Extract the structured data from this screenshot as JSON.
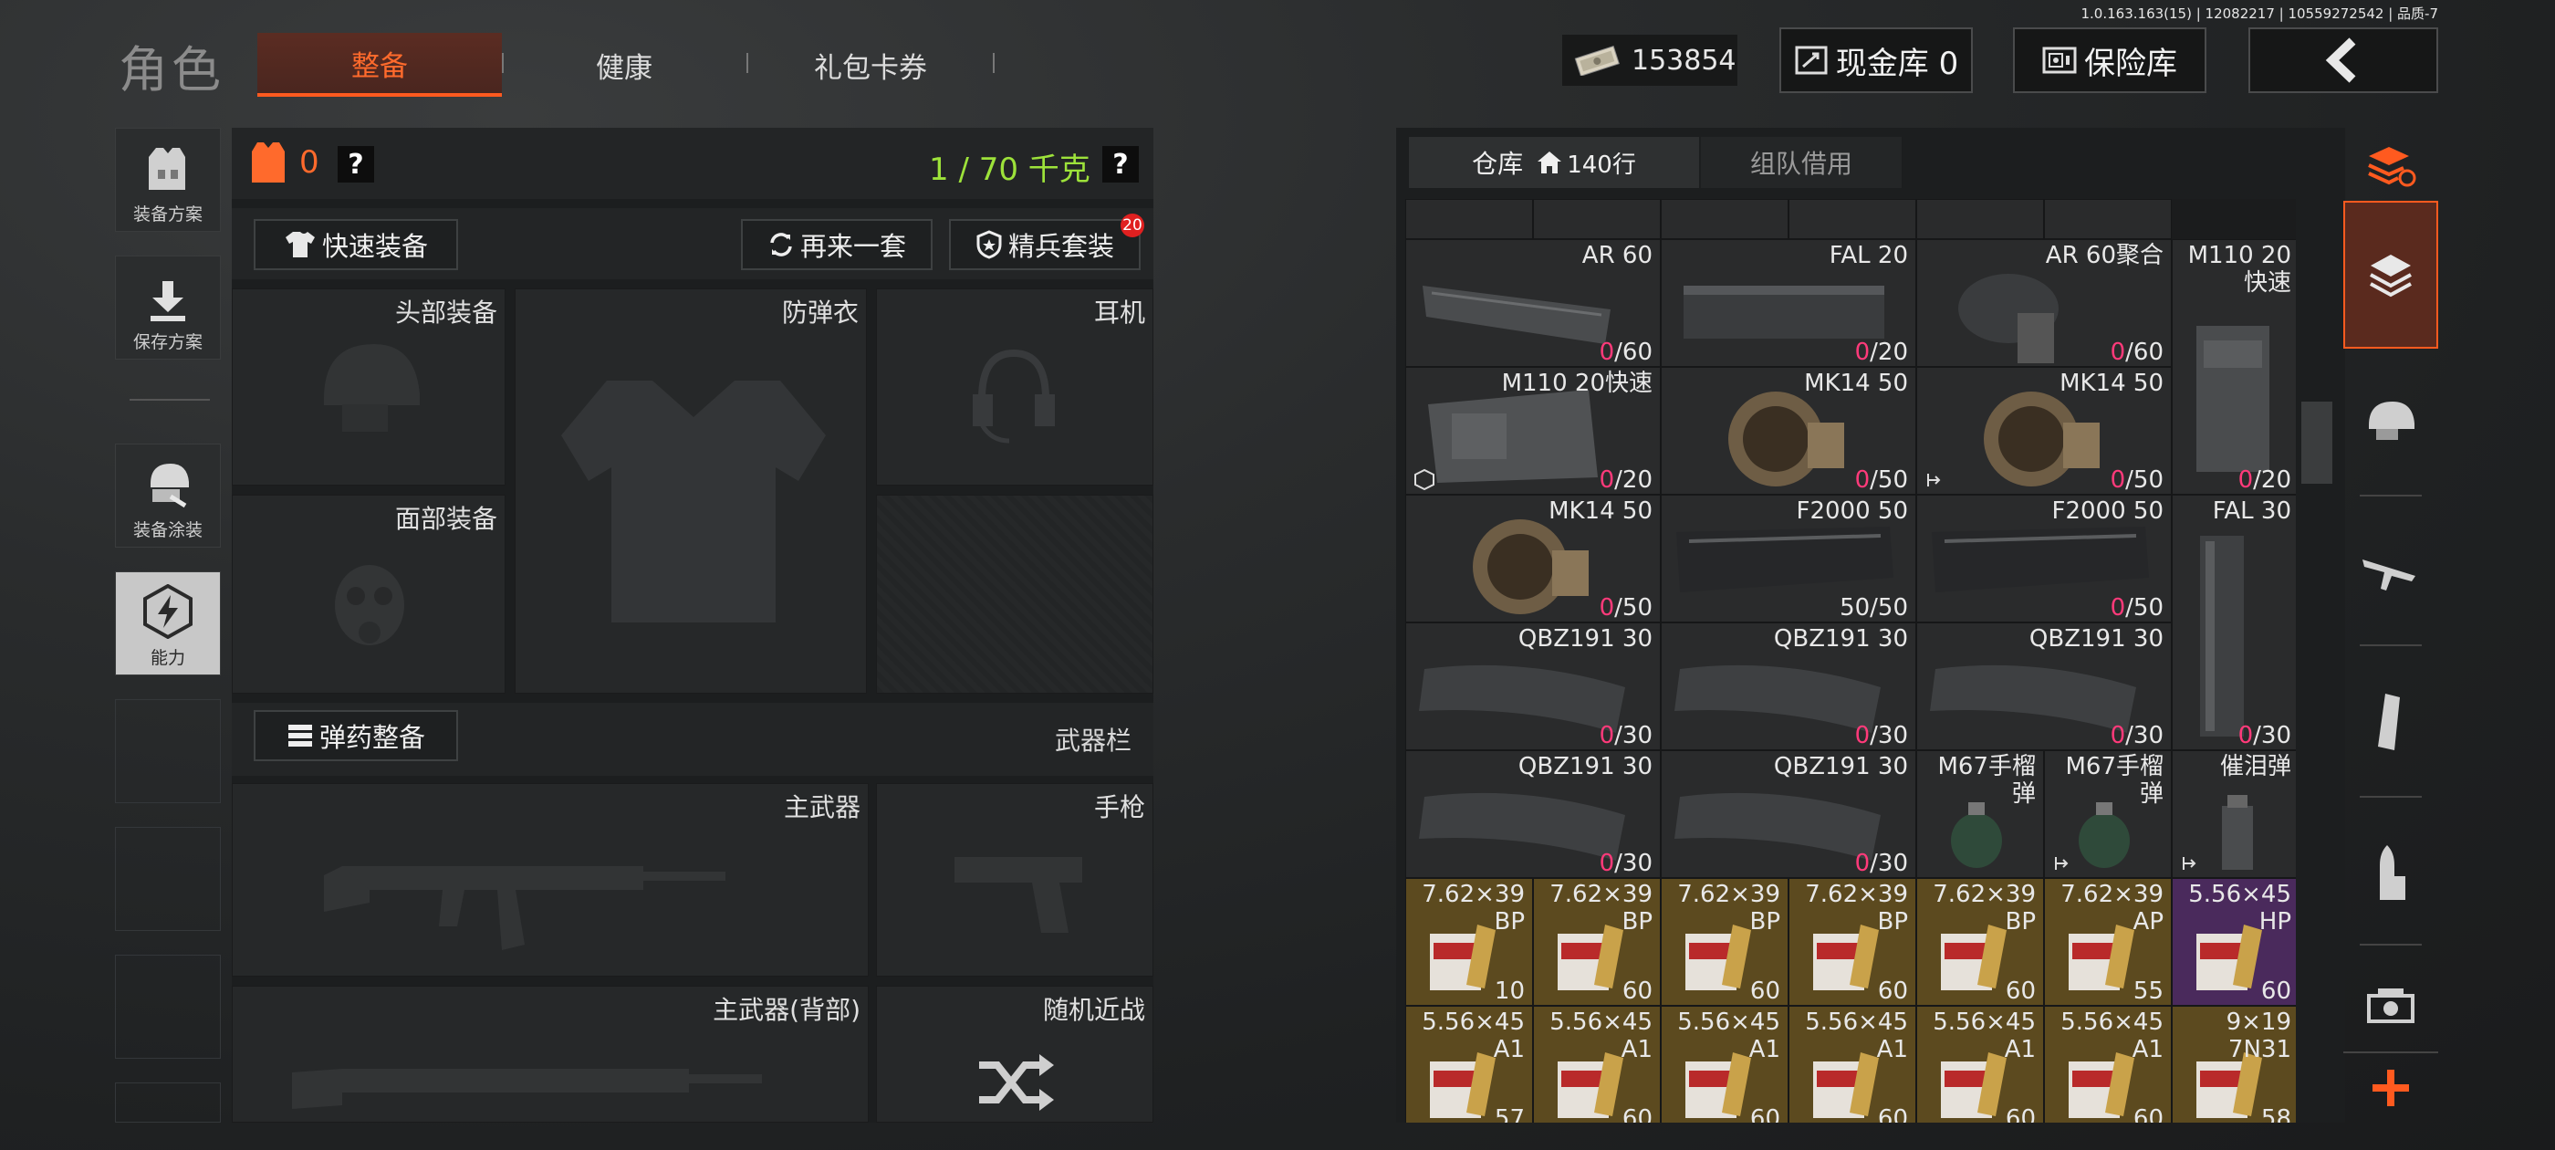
{
  "version": "1.0.163.163(15) | 12082217 | 10559272542 | 品质-7",
  "header": {
    "title": "角色",
    "tabs": [
      {
        "label": "整备",
        "active": true
      },
      {
        "label": "健康",
        "active": false
      },
      {
        "label": "礼包卡券",
        "active": false
      }
    ],
    "money": "153854",
    "cash_vault": "现金库 0",
    "safe_box": "保险库"
  },
  "sidebar": [
    {
      "label": "装备方案",
      "icon": "vest-plan-icon"
    },
    {
      "label": "保存方案",
      "icon": "download-icon"
    },
    {
      "label": "装备涂装",
      "icon": "helmet-paint-icon"
    },
    {
      "label": "能力",
      "icon": "lightning-icon"
    }
  ],
  "equipment": {
    "armor_count": "0",
    "weight": "1 / 70 千克",
    "help": "?",
    "quick_equip": "快速装备",
    "again": "再来一套",
    "elite_kit": "精兵套装",
    "elite_badge": "20",
    "slots": {
      "head": "头部装备",
      "body_armor": "防弹衣",
      "headset": "耳机",
      "face": "面部装备"
    },
    "ammo_equip": "弹药整备",
    "weapon_bar": "武器栏",
    "weapons": {
      "primary": "主武器",
      "pistol": "手枪",
      "primary_back": "主武器(背部)",
      "melee": "随机近战"
    }
  },
  "warehouse": {
    "tab_storage": "仓库",
    "rows": "140行",
    "tab_team": "组队借用",
    "items": [
      {
        "name": "AR 60",
        "count": "0",
        "cap": "/60"
      },
      {
        "name": "FAL 20",
        "count": "0",
        "cap": "/20"
      },
      {
        "name": "AR 60聚合",
        "count": "0",
        "cap": "/60"
      },
      {
        "name": "M110 20\n快速",
        "count": "0",
        "cap": "/20"
      },
      {
        "name": "M110 20快速",
        "count": "0",
        "cap": "/20"
      },
      {
        "name": "MK14 50",
        "count": "0",
        "cap": "/50"
      },
      {
        "name": "MK14 50",
        "count": "0",
        "cap": "/50"
      },
      {
        "name": "MK14 50",
        "count": "0",
        "cap": "/50"
      },
      {
        "name": "F2000 50",
        "full": "50/50"
      },
      {
        "name": "F2000 50",
        "count": "0",
        "cap": "/50"
      },
      {
        "name": "FAL 30",
        "count": "0",
        "cap": "/30"
      },
      {
        "name": "QBZ191 30",
        "count": "0",
        "cap": "/30"
      },
      {
        "name": "QBZ191 30",
        "count": "0",
        "cap": "/30"
      },
      {
        "name": "QBZ191 30",
        "count": "0",
        "cap": "/30"
      },
      {
        "name": "QBZ191 30",
        "count": "0",
        "cap": "/30"
      },
      {
        "name": "QBZ191 30",
        "count": "0",
        "cap": "/30"
      },
      {
        "name": "M67手榴\n弹"
      },
      {
        "name": "M67手榴\n弹"
      },
      {
        "name": "催泪弹"
      }
    ],
    "ammo": [
      {
        "cal": "7.62×39",
        "type": "BP",
        "qty": "10"
      },
      {
        "cal": "7.62×39",
        "type": "BP",
        "qty": "60"
      },
      {
        "cal": "7.62×39",
        "type": "BP",
        "qty": "60"
      },
      {
        "cal": "7.62×39",
        "type": "BP",
        "qty": "60"
      },
      {
        "cal": "7.62×39",
        "type": "BP",
        "qty": "60"
      },
      {
        "cal": "7.62×39",
        "type": "AP",
        "qty": "55"
      },
      {
        "cal": "5.56×45",
        "type": "HP",
        "qty": "60"
      },
      {
        "cal": "5.56×45",
        "type": "A1",
        "qty": "57"
      },
      {
        "cal": "5.56×45",
        "type": "A1",
        "qty": "60"
      },
      {
        "cal": "5.56×45",
        "type": "A1",
        "qty": "60"
      },
      {
        "cal": "5.56×45",
        "type": "A1",
        "qty": "60"
      },
      {
        "cal": "5.56×45",
        "type": "A1",
        "qty": "60"
      },
      {
        "cal": "5.56×45",
        "type": "A1",
        "qty": "60"
      },
      {
        "cal": "9×19",
        "type": "7N31",
        "qty": "58"
      }
    ]
  },
  "colors": {
    "accent": "#ff5a1f",
    "weight": "#9de23a",
    "zero_count": "#ff3a7a"
  }
}
